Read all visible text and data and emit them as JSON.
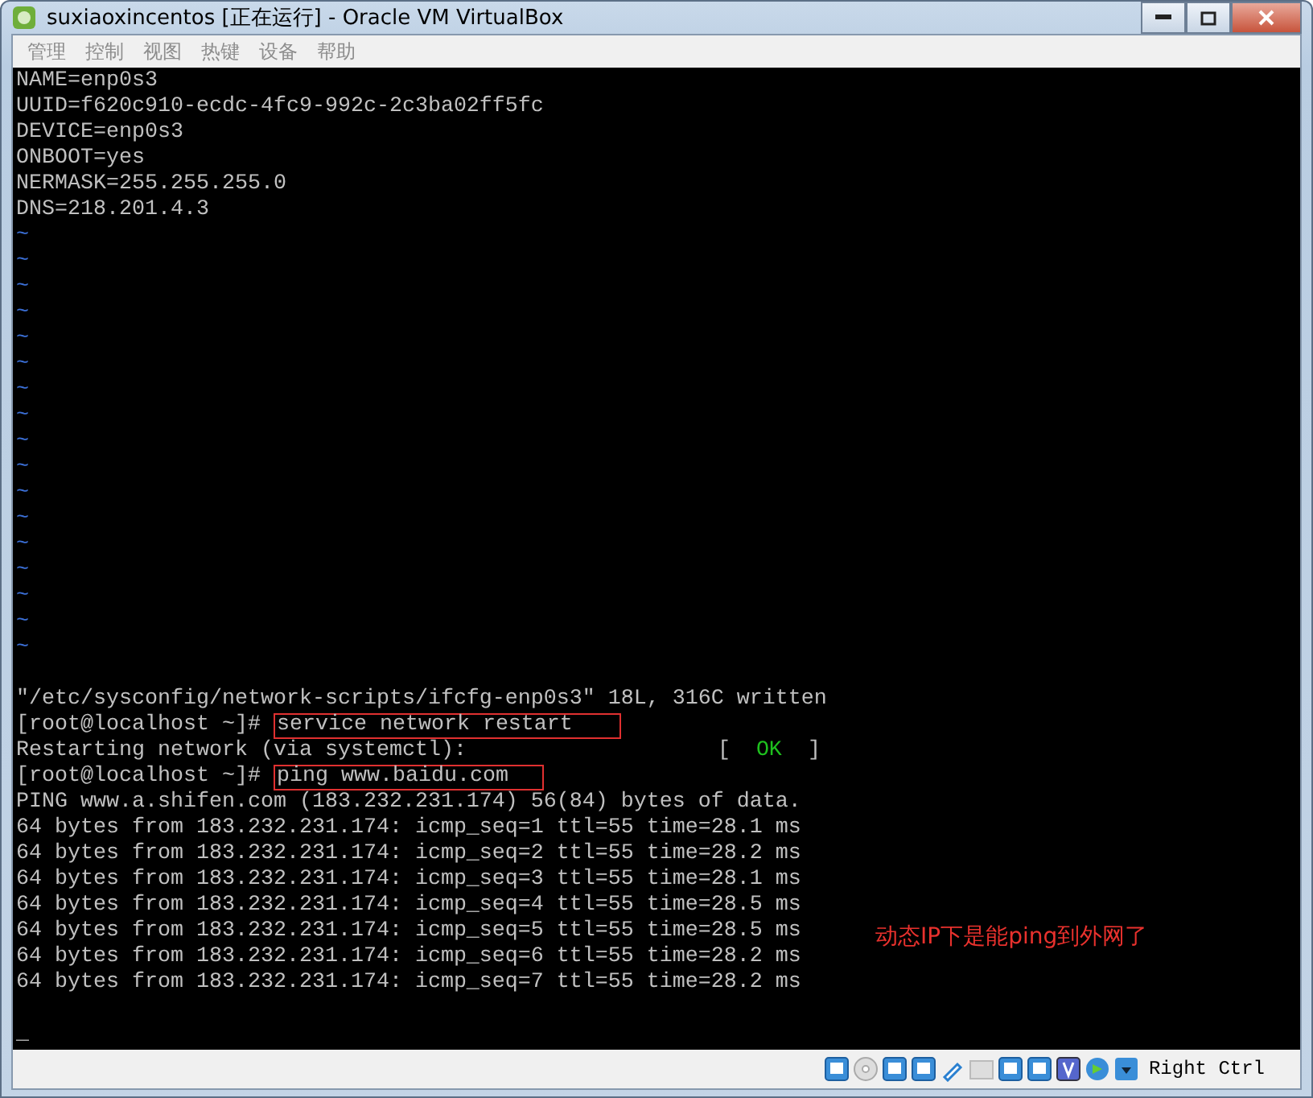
{
  "window": {
    "title": "suxiaoxincentos [正在运行] - Oracle VM VirtualBox"
  },
  "menu": [
    {
      "label": "管理",
      "disabled": true
    },
    {
      "label": "控制",
      "disabled": true
    },
    {
      "label": "视图",
      "disabled": true
    },
    {
      "label": "热键",
      "disabled": true
    },
    {
      "label": "设备",
      "disabled": true
    },
    {
      "label": "帮助",
      "disabled": true
    }
  ],
  "terminal": {
    "lines": [
      {
        "kind": "text",
        "text": "NAME=enp0s3"
      },
      {
        "kind": "text",
        "text": "UUID=f620c910-ecdc-4fc9-992c-2c3ba02ff5fc"
      },
      {
        "kind": "text",
        "text": "DEVICE=enp0s3"
      },
      {
        "kind": "text",
        "text": "ONBOOT=yes"
      },
      {
        "kind": "text",
        "text": "NERMASK=255.255.255.0"
      },
      {
        "kind": "text",
        "text": "DNS=218.201.4.3"
      },
      {
        "kind": "tilde",
        "text": "~"
      },
      {
        "kind": "tilde",
        "text": "~"
      },
      {
        "kind": "tilde",
        "text": "~"
      },
      {
        "kind": "tilde",
        "text": "~"
      },
      {
        "kind": "tilde",
        "text": "~"
      },
      {
        "kind": "tilde",
        "text": "~"
      },
      {
        "kind": "tilde",
        "text": "~"
      },
      {
        "kind": "tilde",
        "text": "~"
      },
      {
        "kind": "tilde",
        "text": "~"
      },
      {
        "kind": "tilde",
        "text": "~"
      },
      {
        "kind": "tilde",
        "text": "~"
      },
      {
        "kind": "tilde",
        "text": "~"
      },
      {
        "kind": "tilde",
        "text": "~"
      },
      {
        "kind": "tilde",
        "text": "~"
      },
      {
        "kind": "tilde",
        "text": "~"
      },
      {
        "kind": "tilde",
        "text": "~"
      },
      {
        "kind": "tilde",
        "text": "~"
      },
      {
        "kind": "blank"
      },
      {
        "kind": "text",
        "text": "\"/etc/sysconfig/network-scripts/ifcfg-enp0s3\" 18L, 316C written"
      },
      {
        "kind": "command",
        "prompt": "[root@localhost ~]#",
        "command": "service network restart"
      },
      {
        "kind": "status",
        "text": "Restarting network (via systemctl):",
        "open": "[",
        "status": "OK",
        "close": "]"
      },
      {
        "kind": "command",
        "prompt": "[root@localhost ~]#",
        "command": "ping www.baidu.com"
      },
      {
        "kind": "text",
        "text": "PING www.a.shifen.com (183.232.231.174) 56(84) bytes of data."
      },
      {
        "kind": "text",
        "text": "64 bytes from 183.232.231.174: icmp_seq=1 ttl=55 time=28.1 ms"
      },
      {
        "kind": "text",
        "text": "64 bytes from 183.232.231.174: icmp_seq=2 ttl=55 time=28.2 ms"
      },
      {
        "kind": "text",
        "text": "64 bytes from 183.232.231.174: icmp_seq=3 ttl=55 time=28.1 ms"
      },
      {
        "kind": "text",
        "text": "64 bytes from 183.232.231.174: icmp_seq=4 ttl=55 time=28.5 ms"
      },
      {
        "kind": "text",
        "text": "64 bytes from 183.232.231.174: icmp_seq=5 ttl=55 time=28.5 ms"
      },
      {
        "kind": "text",
        "text": "64 bytes from 183.232.231.174: icmp_seq=6 ttl=55 time=28.2 ms"
      },
      {
        "kind": "text",
        "text": "64 bytes from 183.232.231.174: icmp_seq=7 ttl=55 time=28.2 ms"
      },
      {
        "kind": "blank"
      },
      {
        "kind": "cursor",
        "text": "_"
      }
    ],
    "annotation": "动态IP下是能ping到外网了"
  },
  "status_bar": {
    "host_key": "Right Ctrl"
  }
}
